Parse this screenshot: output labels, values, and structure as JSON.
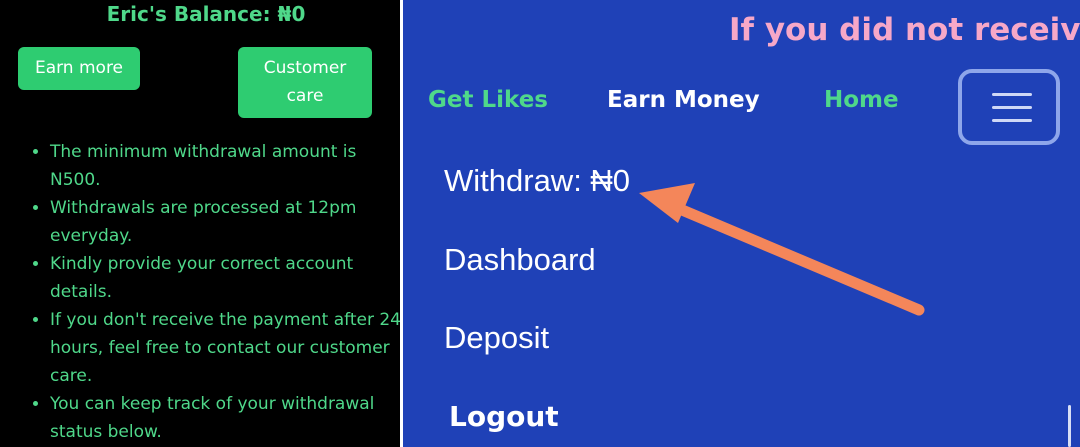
{
  "left": {
    "balance": "Eric's Balance: ₦0",
    "buttons": {
      "earn_more": "Earn more",
      "customer_care_line1": "Customer",
      "customer_care_line2": "care"
    },
    "info": [
      "The minimum withdrawal amount is N500.",
      "Withdrawals are processed at 12pm everyday.",
      "Kindly provide your correct account details.",
      "If you don't receive the payment after 24 hours, feel free to contact our customer care.",
      "You can keep track of your withdrawal status below."
    ]
  },
  "right": {
    "marquee": "If you did not receive t",
    "nav": {
      "get_likes": "Get Likes",
      "earn_money": "Earn Money",
      "home": "Home"
    },
    "menu": {
      "withdraw": "Withdraw: ₦0",
      "dashboard": "Dashboard",
      "deposit": "Deposit",
      "logout": "Logout"
    }
  },
  "colors": {
    "left_bg": "#000000",
    "accent_green": "#4fd88a",
    "button_green": "#2ecc71",
    "right_bg": "#1f41b7",
    "marquee_pink": "#f6a8c8",
    "arrow_orange": "#f4865a"
  },
  "icons": {
    "menu": "hamburger-menu-icon",
    "annotation": "arrow-icon"
  }
}
